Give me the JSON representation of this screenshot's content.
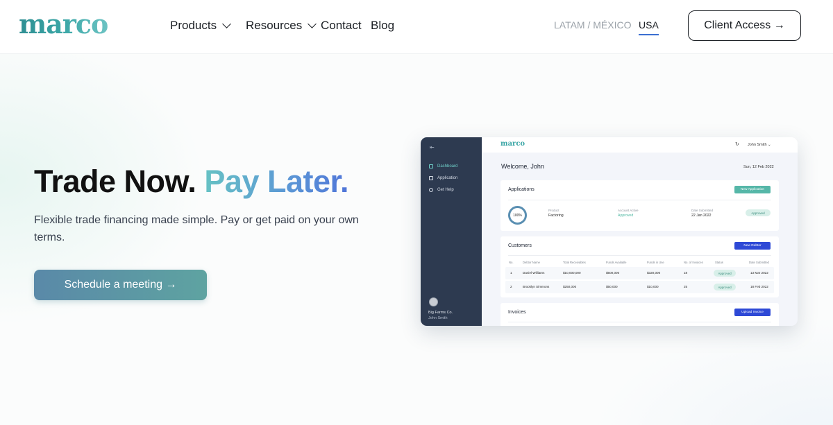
{
  "brand": {
    "logo_text": "marco"
  },
  "nav": {
    "items": [
      {
        "label": "Products",
        "has_dropdown": true
      },
      {
        "label": "Resources",
        "has_dropdown": true
      },
      {
        "label": "Contact"
      },
      {
        "label": "Blog"
      }
    ],
    "regions": [
      {
        "label": "LATAM / MÉXICO",
        "active": false
      },
      {
        "label": "USA",
        "active": true
      }
    ],
    "client_access": "Client Access →"
  },
  "hero": {
    "headline_plain": "Trade Now.",
    "headline_accent": "Pay Later.",
    "subtitle": "Flexible trade financing made simple. Pay or get paid on your own terms.",
    "cta": "Schedule a meeting →"
  },
  "dashboard": {
    "logo": "marco",
    "collapse_icon": "⇤",
    "sidebar": [
      "Dashboard",
      "Application",
      "Get Help"
    ],
    "sidebar_active": "Dashboard",
    "company": "Big Farms Co.",
    "user": "John Smith",
    "top_user": "John Smith ⌄",
    "refresh_icon": "↻",
    "welcome": "Welcome, John",
    "date": "Sun, 12 Feb 2022",
    "applications": {
      "title": "Applications",
      "button": "New Application",
      "progress": "100%",
      "product_label": "Product",
      "product_value": "Factoring",
      "account_label": "Account Active",
      "account_value": "Approved",
      "submitted_label": "Date Submitted",
      "submitted_value": "22 Jan 2022",
      "status": "Approved"
    },
    "customers": {
      "title": "Customers",
      "button": "New Debtor",
      "columns": [
        "No.",
        "Debtor Name",
        "Total Receivables",
        "Funds Available",
        "Funds in Use",
        "No. of Invoices",
        "Status",
        "Date Submitted"
      ],
      "rows": [
        [
          "1",
          "Daniel Williams",
          "$10,000,000",
          "$500,000",
          "$320,000",
          "18",
          "Approved",
          "13 Mar 2022"
        ],
        [
          "2",
          "Brooklyn Simmons",
          "$250,000",
          "$50,000",
          "$10,000",
          "25",
          "Approved",
          "18 Feb 2022"
        ]
      ]
    },
    "invoices": {
      "title": "Invoices",
      "button": "Upload Invoice"
    }
  }
}
